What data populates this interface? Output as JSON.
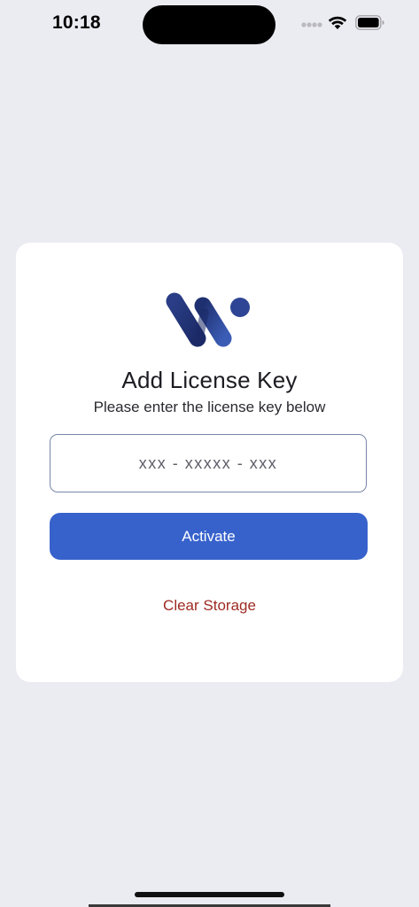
{
  "status_bar": {
    "time": "10:18",
    "icons": [
      "cellular-signal-icon",
      "wifi-icon",
      "battery-icon"
    ]
  },
  "card": {
    "logo": "app-logo",
    "title": "Add License Key",
    "subtitle": "Please enter the license key below",
    "license_input": {
      "placeholder": "xxx - xxxxx - xxx",
      "value": ""
    },
    "activate_label": "Activate",
    "clear_storage_label": "Clear Storage"
  },
  "colors": {
    "background": "#EBEBF2",
    "card": "#FFFFFF",
    "primary_button": "#3762CC",
    "clear_storage_text": "#9E2A22",
    "logo_navy": "#1E2F6E"
  }
}
